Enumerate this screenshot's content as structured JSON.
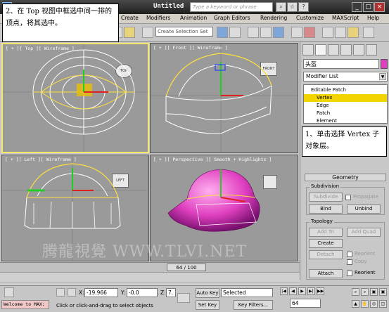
{
  "titlebar": {
    "title": "Untitled",
    "search_placeholder": "Type a keyword or phrase"
  },
  "menubar": {
    "items": [
      "Create",
      "Modifiers",
      "Animation",
      "Graph Editors",
      "Rendering",
      "Customize",
      "MAXScript",
      "Help"
    ]
  },
  "toolbar": {
    "selection_set_placeholder": "Create Selection Set"
  },
  "callouts": {
    "top_left": "2、在 Top 视图中框选中间一排的顶点，将其选中。",
    "right": "1、单击选择 Vertex 子对象层。"
  },
  "viewports": {
    "top": {
      "label": "[ + ][ Top ][ Wireframe ]",
      "cube": "TOP"
    },
    "front": {
      "label": "[ + ][ Front ][ Wireframe ]",
      "cube": "FRONT"
    },
    "left": {
      "label": "[ + ][ Left ][ Wireframe ]",
      "cube": "LEFT"
    },
    "perspective": {
      "label": "[ + ][ Perspective ][ Smooth + Highlights ]"
    }
  },
  "cmdpanel": {
    "object_name": "头盔",
    "object_color": "#e040c0",
    "modifier_list": "Modifier List",
    "stack": [
      "Editable Patch",
      "Vertex",
      "Edge",
      "Patch",
      "Element"
    ],
    "selected_stack_item": "Vertex",
    "geometry_title": "Geometry",
    "subdivision_title": "Subdivision",
    "subdivide_label": "Subdivide",
    "propagate_label": "Propagate",
    "bind_label": "Bind",
    "unbind_label": "Unbind",
    "topology_title": "Topology",
    "add_tri_label": "Add Tri",
    "add_quad_label": "Add Quad",
    "create_label": "Create",
    "detach_label": "Detach",
    "reorient_label": "Reorient",
    "copy_label": "Copy",
    "attach_label": "Attach",
    "reorient2_label": "Reorient"
  },
  "timeslider": {
    "label": "64 / 100",
    "current_frame": 64,
    "total_frames": 100
  },
  "statusbar": {
    "maxscript": "Welcome to MAX:",
    "prompt": "Click or click-and-drag to select objects",
    "x_label": "X:",
    "x_value": "-19.966",
    "y_label": "Y:",
    "y_value": "-0.0",
    "z_label": "Z:",
    "z_value": "7.",
    "auto_key_label": "Auto Key",
    "set_key_label": "Set Key",
    "selected_option": "Selected",
    "key_filters_label": "Key Filters...",
    "frame_value": "64"
  },
  "watermark": "腾龍視覺 WWW.TLVI.NET",
  "colors": {
    "viewport_bg": "#9a9a9a",
    "active_border": "#f4e86a",
    "helmet_pink": "#e040c0",
    "selected_stack": "#f1d400"
  }
}
